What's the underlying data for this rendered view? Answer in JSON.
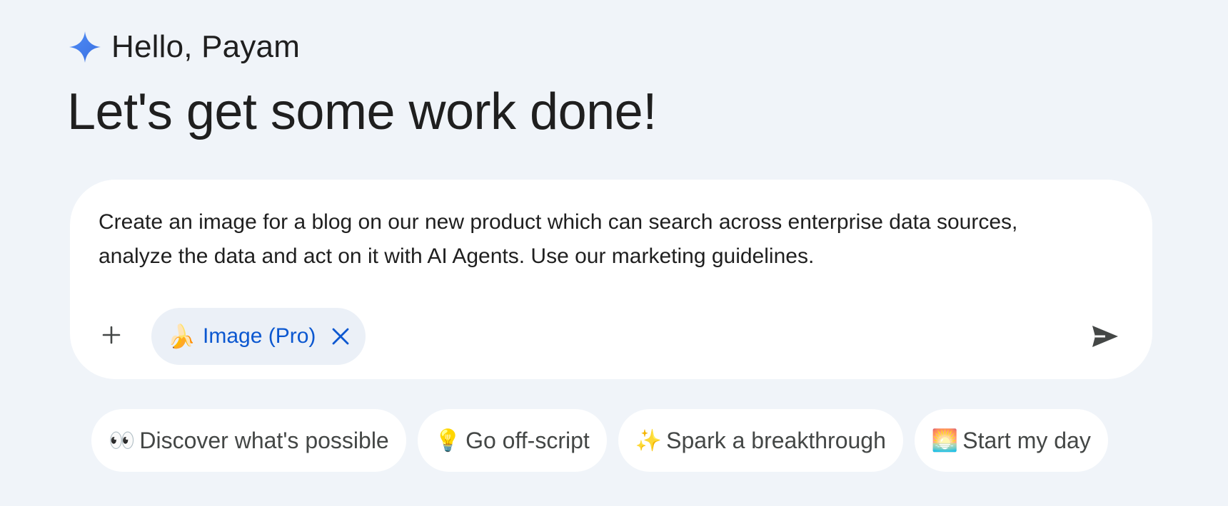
{
  "greeting": "Hello, Payam",
  "headline": "Let's get some work done!",
  "composer": {
    "prompt": "Create an image for a blog on our new product which can search across enterprise data sources,\nanalyze the data and act on it with AI Agents. Use our marketing guidelines.",
    "tool_chip": {
      "emoji": "🍌",
      "label": "Image (Pro)"
    }
  },
  "suggestions": [
    {
      "emoji": "👀",
      "label": "Discover what's possible"
    },
    {
      "emoji": "💡",
      "label": "Go off-script"
    },
    {
      "emoji": "✨",
      "label": "Spark a breakthrough"
    },
    {
      "emoji": "🌅",
      "label": "Start my day"
    }
  ],
  "colors": {
    "background": "#f0f4f9",
    "accent": "#0b57d0",
    "spark_blue": "#4285f4"
  },
  "icons": {
    "spark": "gemini-spark-icon",
    "add": "plus-icon",
    "close": "close-icon",
    "send": "send-icon"
  }
}
